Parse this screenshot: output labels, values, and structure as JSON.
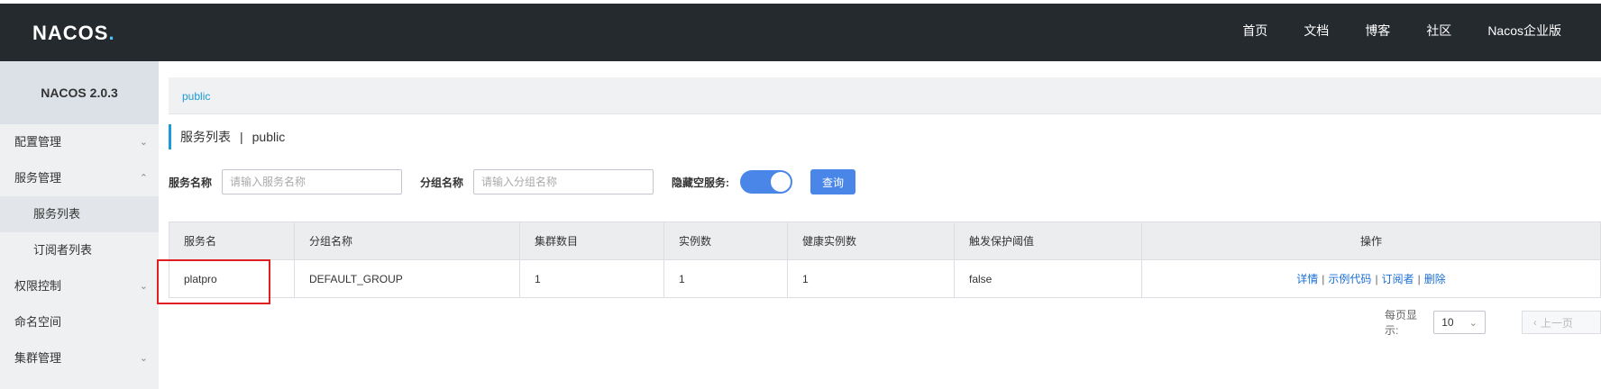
{
  "brand": {
    "logo_text": "NACOS",
    "logo_dot": "."
  },
  "nav": {
    "items": [
      "首页",
      "文档",
      "博客",
      "社区",
      "Nacos企业版"
    ]
  },
  "sidebar": {
    "version": "NACOS 2.0.3",
    "items": [
      {
        "label": "配置管理",
        "chevron": "chevron-down"
      },
      {
        "label": "服务管理",
        "chevron": "chevron-up"
      },
      {
        "label": "服务列表"
      },
      {
        "label": "订阅者列表"
      },
      {
        "label": "权限控制",
        "chevron": "chevron-down"
      },
      {
        "label": "命名空间"
      },
      {
        "label": "集群管理",
        "chevron": "chevron-down"
      }
    ]
  },
  "breadcrumb": {
    "namespace": "public"
  },
  "page": {
    "title": "服务列表",
    "separator": "|",
    "namespace": "public"
  },
  "filters": {
    "service_name_label": "服务名称",
    "service_name_placeholder": "请输入服务名称",
    "group_name_label": "分组名称",
    "group_name_placeholder": "请输入分组名称",
    "hide_empty_label": "隐藏空服务:",
    "hide_empty_on": true,
    "query_label": "查询"
  },
  "table": {
    "headers": [
      "服务名",
      "分组名称",
      "集群数目",
      "实例数",
      "健康实例数",
      "触发保护阈值",
      "操作"
    ],
    "rows": [
      {
        "service": "platpro",
        "group": "DEFAULT_GROUP",
        "clusters": "1",
        "instances": "1",
        "healthy": "1",
        "threshold": "false",
        "ops": [
          "详情",
          "示例代码",
          "订阅者",
          "删除"
        ]
      }
    ]
  },
  "pagination": {
    "page_size_label": "每页显示:",
    "page_size": "10",
    "prev_label": "上一页"
  },
  "colors": {
    "accent": "#4a86e8",
    "topbar": "#252a2f",
    "link": "#1a6fd6",
    "highlight": "#e02020"
  }
}
